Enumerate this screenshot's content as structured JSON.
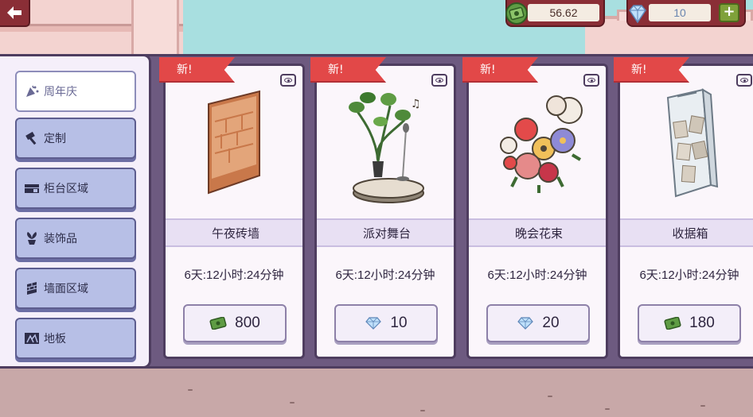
{
  "currency": {
    "cash": "56.62",
    "gems": "10",
    "plus_label": "+"
  },
  "sidebar": {
    "tabs": [
      {
        "label": "周年庆",
        "icon": "party-popper-icon",
        "active": true
      },
      {
        "label": "定制",
        "icon": "hammer-icon",
        "active": false
      },
      {
        "label": "柜台区域",
        "icon": "counter-icon",
        "active": false
      },
      {
        "label": "装饰品",
        "icon": "plant-icon",
        "active": false
      },
      {
        "label": "墙面区域",
        "icon": "wall-icon",
        "active": false
      },
      {
        "label": "地板",
        "icon": "floor-icon",
        "active": false
      }
    ]
  },
  "items": [
    {
      "badge": "新!",
      "name": "午夜砖墙",
      "timer": "6天:12小时:24分钟",
      "price": "800",
      "currency": "cash",
      "image": "brick-wall-panel"
    },
    {
      "badge": "新!",
      "name": "派对舞台",
      "timer": "6天:12小时:24分钟",
      "price": "10",
      "currency": "gem",
      "image": "potted-plant-stage-with-microphone"
    },
    {
      "badge": "新!",
      "name": "晚会花束",
      "timer": "6天:12小时:24分钟",
      "price": "20",
      "currency": "gem",
      "image": "flower-bouquet"
    },
    {
      "badge": "新!",
      "name": "收据箱",
      "timer": "6天:12小时:24分钟",
      "price": "180",
      "currency": "cash",
      "image": "glass-receipt-box"
    }
  ],
  "colors": {
    "panel": "#6d5a80",
    "ribbon": "#e24848",
    "cash_green": "#4f8a3a",
    "gem_blue": "#9ec8f0"
  }
}
